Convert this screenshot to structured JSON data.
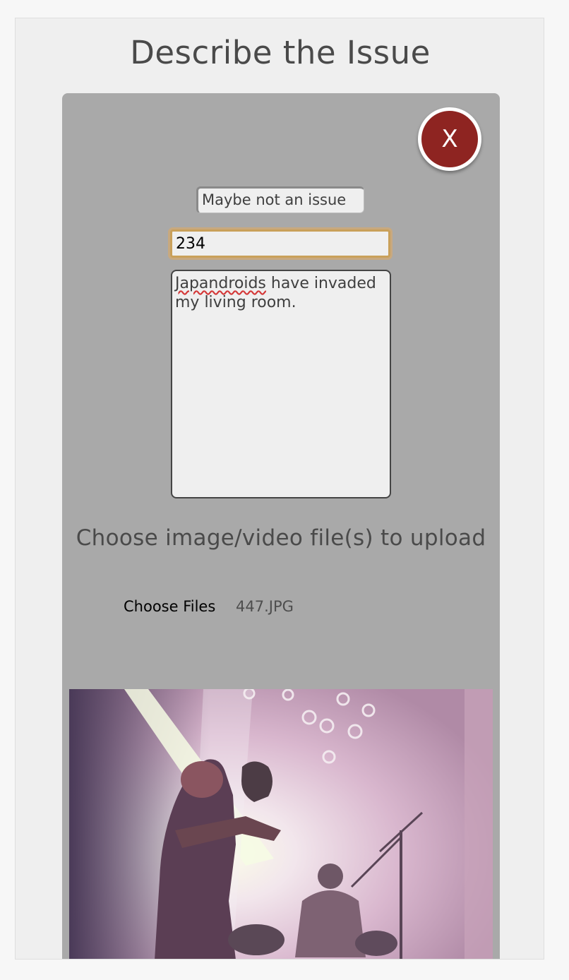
{
  "page": {
    "title": "Describe the Issue"
  },
  "form": {
    "close_label": "X",
    "category_value": "Maybe not an issue",
    "number_value": "234",
    "description_word_misspelled": "Japandroids",
    "description_rest": " have invaded\nmy living room."
  },
  "upload": {
    "heading": "Choose image/video file(s) to upload",
    "button_label": "Choose Files",
    "file_name": "447.JPG"
  },
  "colors": {
    "panel_bg": "#efefef",
    "card_bg": "#a9a9a9",
    "close_button": "#8e2421",
    "focus_ring": "#c9a05a"
  },
  "preview": {
    "icon": "uploaded-photo"
  }
}
